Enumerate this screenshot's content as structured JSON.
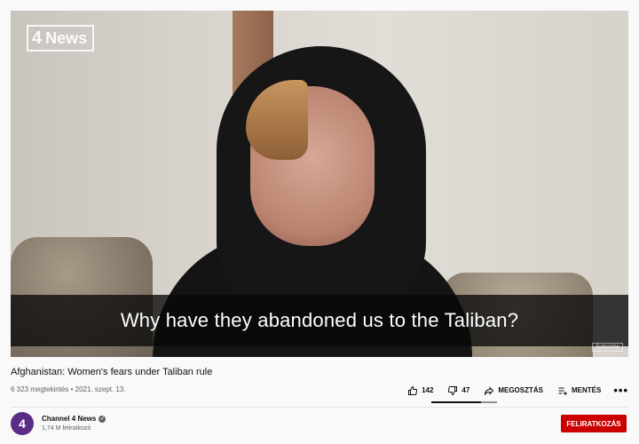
{
  "player": {
    "channel_bug": {
      "logo_glyph": "4",
      "label": "News"
    },
    "caption": "Why have they abandoned us to the Taliban?",
    "end_card_subscribe": "Subscribe"
  },
  "video": {
    "title": "Afghanistan: Women's fears under Taliban rule",
    "meta": "6 323 megtekintés • 2021. szept. 13.",
    "likes": "142",
    "dislikes": "47",
    "like_ratio": 0.75,
    "share_label": "MEGOSZTÁS",
    "save_label": "MENTÉS",
    "more_label": "•••"
  },
  "channel": {
    "avatar_glyph": "4",
    "name": "Channel 4 News",
    "verified_glyph": "✓",
    "subscribers": "1,74 M feliratkozó",
    "subscribe_label": "FELIRATKOZÁS"
  },
  "colors": {
    "subscribe": "#cc0000",
    "avatar": "#5b2c86"
  }
}
